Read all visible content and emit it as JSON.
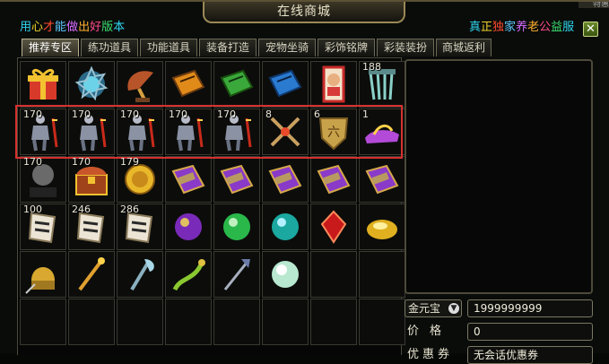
{
  "window": {
    "title": "在线商城",
    "corner_tag": "特惠"
  },
  "banner_left": {
    "segments": [
      {
        "text": "用",
        "color": "#2fd6f0"
      },
      {
        "text": "心",
        "color": "#f0d22a"
      },
      {
        "text": "才",
        "color": "#ff4a2e"
      },
      {
        "text": "能",
        "color": "#5cc8ff"
      },
      {
        "text": "做",
        "color": "#d66bff"
      },
      {
        "text": "出",
        "color": "#ffb02e"
      },
      {
        "text": "好",
        "color": "#ff4a8a"
      },
      {
        "text": "版",
        "color": "#3ae070"
      },
      {
        "text": "本",
        "color": "#2fd6f0"
      }
    ]
  },
  "banner_right": {
    "segments": [
      {
        "text": "真",
        "color": "#2fd6f0"
      },
      {
        "text": "正",
        "color": "#f0d22a"
      },
      {
        "text": "独",
        "color": "#ff4a2e"
      },
      {
        "text": "家",
        "color": "#5cc8ff"
      },
      {
        "text": "养",
        "color": "#d66bff"
      },
      {
        "text": "老",
        "color": "#ffb02e"
      },
      {
        "text": "公",
        "color": "#ff4a8a"
      },
      {
        "text": "益",
        "color": "#3ae070"
      },
      {
        "text": "服",
        "color": "#2fd6f0"
      }
    ]
  },
  "tabs": [
    {
      "label": "推荐专区",
      "active": true
    },
    {
      "label": "练功道具",
      "active": false
    },
    {
      "label": "功能道具",
      "active": false
    },
    {
      "label": "装备打造",
      "active": false
    },
    {
      "label": "宠物坐骑",
      "active": false
    },
    {
      "label": "彩饰铭牌",
      "active": false
    },
    {
      "label": "彩装装扮",
      "active": false
    },
    {
      "label": "商城返利",
      "active": false
    }
  ],
  "grid": {
    "rows": [
      [
        {
          "icon": "gift-box-icon",
          "count": ""
        },
        {
          "icon": "ornate-shield-icon",
          "count": ""
        },
        {
          "icon": "gramophone-icon",
          "count": ""
        },
        {
          "icon": "orange-scroll-book-icon",
          "count": ""
        },
        {
          "icon": "green-scroll-book-icon",
          "count": ""
        },
        {
          "icon": "blue-scroll-book-icon",
          "count": ""
        },
        {
          "icon": "fortune-card-icon",
          "count": ""
        },
        {
          "icon": "spirit-chains-icon",
          "count": "188"
        }
      ],
      [
        {
          "icon": "armor-set-icon",
          "count": "170"
        },
        {
          "icon": "armor-set-icon",
          "count": "170"
        },
        {
          "icon": "armor-set-icon",
          "count": "170"
        },
        {
          "icon": "armor-set-icon",
          "count": "170"
        },
        {
          "icon": "armor-set-icon",
          "count": "170"
        },
        {
          "icon": "crossed-weapons-icon",
          "count": "8"
        },
        {
          "icon": "golden-medal-icon",
          "count": "6"
        },
        {
          "icon": "golden-slipper-icon",
          "count": "1"
        }
      ],
      [
        {
          "icon": "treasure-token-icon",
          "count": "170"
        },
        {
          "icon": "treasure-chest-icon",
          "count": "170"
        },
        {
          "icon": "tiger-coin-icon",
          "count": "179"
        },
        {
          "icon": "purple-scroll-icon",
          "count": ""
        },
        {
          "icon": "purple-scroll-icon",
          "count": ""
        },
        {
          "icon": "purple-scroll-icon",
          "count": ""
        },
        {
          "icon": "purple-scroll-icon",
          "count": ""
        },
        {
          "icon": "purple-scroll-icon",
          "count": ""
        }
      ],
      [
        {
          "icon": "paper-scroll-icon",
          "count": "100"
        },
        {
          "icon": "paper-scroll-icon",
          "count": "246"
        },
        {
          "icon": "paper-scroll-icon",
          "count": "286"
        },
        {
          "icon": "purple-orb-icon",
          "count": ""
        },
        {
          "icon": "green-orb-icon",
          "count": ""
        },
        {
          "icon": "teal-orb-icon",
          "count": ""
        },
        {
          "icon": "red-gem-icon",
          "count": ""
        },
        {
          "icon": "gold-ingot-icon",
          "count": ""
        }
      ],
      [
        {
          "icon": "golden-helmet-icon",
          "count": ""
        },
        {
          "icon": "golden-staff-icon",
          "count": ""
        },
        {
          "icon": "crystal-axe-icon",
          "count": ""
        },
        {
          "icon": "dragon-ornament-icon",
          "count": ""
        },
        {
          "icon": "trident-icon",
          "count": ""
        },
        {
          "icon": "pale-orb-icon",
          "count": ""
        },
        {
          "icon": "",
          "count": ""
        },
        {
          "icon": "",
          "count": ""
        }
      ],
      [
        {
          "icon": "",
          "count": ""
        },
        {
          "icon": "",
          "count": ""
        },
        {
          "icon": "",
          "count": ""
        },
        {
          "icon": "",
          "count": ""
        },
        {
          "icon": "",
          "count": ""
        },
        {
          "icon": "",
          "count": ""
        },
        {
          "icon": "",
          "count": ""
        },
        {
          "icon": "",
          "count": ""
        }
      ]
    ]
  },
  "purchase": {
    "currency": "金元宝",
    "amount": "1999999999",
    "price_label": "价格",
    "price_value": "0",
    "coupon_label": "优惠券",
    "coupon_value": "无会话优惠券"
  },
  "colors": {
    "highlight": "#d5312f",
    "accent_gold": "#9a8a56"
  }
}
